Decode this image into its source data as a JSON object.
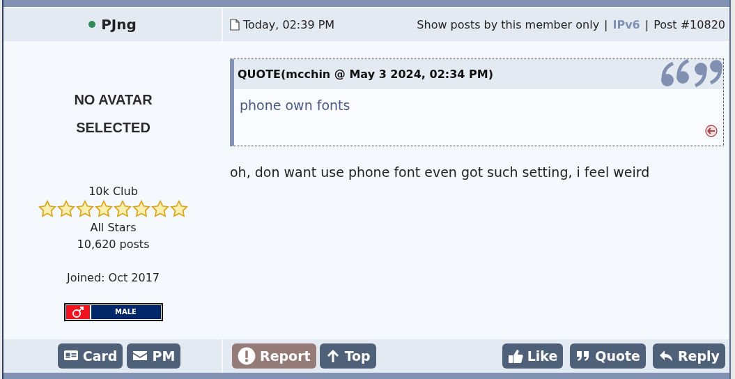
{
  "author": {
    "name": "PJng",
    "online": true
  },
  "post_header": {
    "date": "Today, 02:39 PM",
    "links": [
      {
        "kind": "link",
        "text": "Show posts by this member only"
      },
      {
        "kind": "separator",
        "text": "|"
      },
      {
        "kind": "ip",
        "text": "IPv6"
      },
      {
        "kind": "separator",
        "text": "|"
      },
      {
        "kind": "link",
        "text": "Post #10820"
      }
    ]
  },
  "profile": {
    "avatar_lines": [
      "NO AVATAR",
      "SELECTED"
    ],
    "group": "10k Club",
    "stars": 8,
    "rank": "All Stars",
    "posts": "10,620 posts",
    "joined": "Joined: Oct 2017",
    "gender": "MALE"
  },
  "quote": {
    "header": "QUOTE(mcchin @ May 3 2024, 02:34 PM)",
    "body": "phone own fonts"
  },
  "message": "oh, don want use phone font even got such setting, i feel weird",
  "buttons": {
    "left": [
      {
        "kind": "card",
        "label": "Card"
      },
      {
        "kind": "mail",
        "label": "PM"
      }
    ],
    "middle": [
      {
        "kind": "alert",
        "label": "Report"
      },
      {
        "kind": "up",
        "label": "Top"
      }
    ],
    "right": [
      {
        "kind": "thumb",
        "label": "Like"
      },
      {
        "kind": "quote",
        "label": "Quote"
      },
      {
        "kind": "reply",
        "label": "Reply"
      }
    ]
  }
}
